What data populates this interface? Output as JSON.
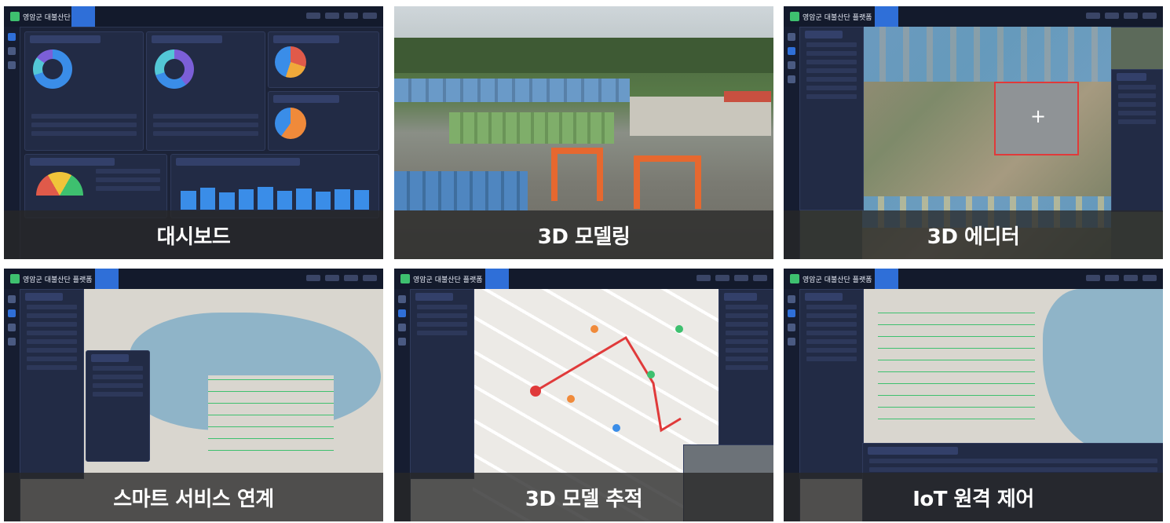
{
  "tiles": [
    {
      "id": "dashboard",
      "caption": "대시보드"
    },
    {
      "id": "modeling",
      "caption": "3D 모델링"
    },
    {
      "id": "editor",
      "caption": "3D 에디터"
    },
    {
      "id": "smart",
      "caption": "스마트 서비스 연계"
    },
    {
      "id": "tracking",
      "caption": "3D 모델 추적"
    },
    {
      "id": "iot",
      "caption": "IoT 원격 제어"
    }
  ],
  "app": {
    "name": "영암군 대불산단 플랫폼"
  },
  "colors": {
    "accent": "#2f6fd8",
    "caption_bg": "#282828",
    "map_water": "#8fb4c8",
    "map_land": "#d9d6cf"
  }
}
